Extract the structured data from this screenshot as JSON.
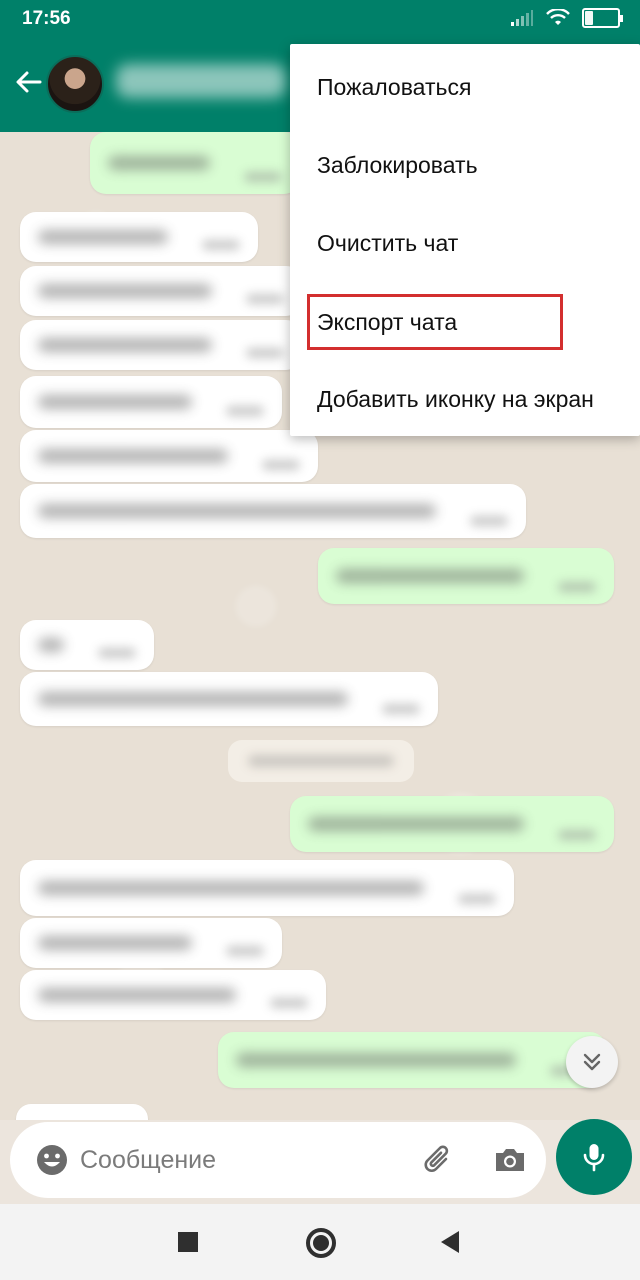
{
  "status_bar": {
    "time": "17:56",
    "battery": "28",
    "battery_level": 0.28
  },
  "colors": {
    "primary": "#008069",
    "outgoing_bubble": "#d9fdd3",
    "highlight_border": "#d32f2f"
  },
  "icons": {
    "back": "arrow-left-icon",
    "emoji": "emoji-icon",
    "attach": "paperclip-icon",
    "camera": "camera-icon",
    "mic": "microphone-icon",
    "scroll_down": "double-chevron-down-icon"
  },
  "menu": {
    "items": [
      {
        "label": "Пожаловаться"
      },
      {
        "label": "Заблокировать"
      },
      {
        "label": "Очистить чат"
      },
      {
        "label": "Экспорт чата"
      },
      {
        "label": "Добавить иконку на экран"
      }
    ]
  },
  "composer": {
    "placeholder": "Сообщение"
  }
}
